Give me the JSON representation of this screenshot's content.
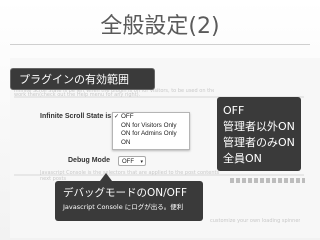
{
  "slide": {
    "title": "全般設定(2)"
  },
  "settings": {
    "infinite_scroll_label": "Infinite Scroll State is",
    "options": [
      {
        "label": "OFF",
        "checked": true
      },
      {
        "label": "ON for Visitors Only",
        "checked": false
      },
      {
        "label": "ON for Admins Only",
        "checked": false
      },
      {
        "label": "ON",
        "checked": false
      }
    ],
    "checkmark": "✓",
    "debug_label": "Debug Mode",
    "debug_value": "OFF",
    "debug_arrow": "▾"
  },
  "callouts": {
    "enable_range": "プラグインの有効範囲",
    "states": [
      "OFF",
      "管理者以外ON",
      "管理者のみON",
      "全員ON"
    ],
    "debug_title": "デバッグモードのON/OFF",
    "debug_desc": "Javascript Console にログが出る。便利"
  },
  "background_text": {
    "line1": "Infinite Scroll State is be left when the plugin is on for visitors, to be used on themes in the selectors tab, option is that the documentation of work at the plugin.",
    "line2": "work then(check out the Help menu for any right).",
    "line3": "Javascript Console is the selectors that are applied to the post contents on page load.",
    "line4": "next posts",
    "line5": "customize your own loading spinner."
  },
  "colors": {
    "callout_bg": "#3a3a3a",
    "title_text": "#5a5a5a"
  }
}
